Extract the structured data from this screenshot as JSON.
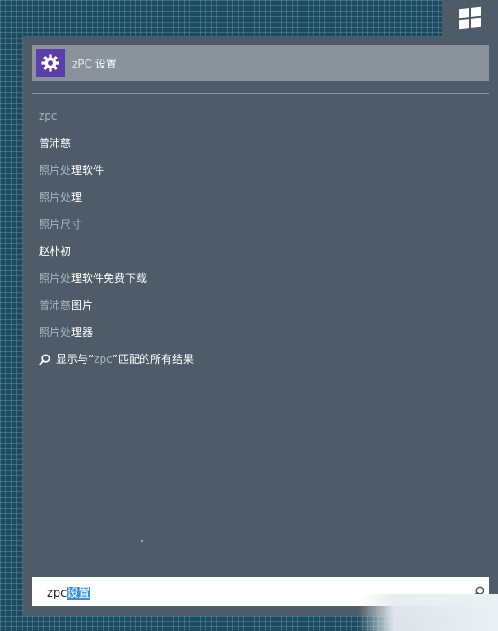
{
  "top_result": {
    "name_query": "zPC",
    "name_rest": " 设置",
    "icon": "gear-icon"
  },
  "suggestions": [
    {
      "q": "zpc",
      "rest": ""
    },
    {
      "q": "",
      "rest": "曾沛慈"
    },
    {
      "q": "照片处",
      "rest": "理软件"
    },
    {
      "q": "照片处",
      "rest": "理"
    },
    {
      "q": "照片尺寸",
      "rest": ""
    },
    {
      "q": "",
      "rest": "赵朴初"
    },
    {
      "q": "照片处",
      "rest": "理软件免费下载"
    },
    {
      "q": "曾沛慈",
      "rest": "图片"
    },
    {
      "q": "照片处",
      "rest": "理器"
    }
  ],
  "see_all": {
    "prefix": "显示与“",
    "query": "zpc",
    "suffix": "”匹配的所有结果",
    "icon": "search-icon"
  },
  "search": {
    "typed": "zpc",
    "selected": "设置",
    "icon": "search-icon"
  },
  "colors": {
    "panel": "#4e5b68",
    "highlight": "#8a939c",
    "app_tile": "#5b3fa8",
    "selection": "#3c8fd6"
  }
}
